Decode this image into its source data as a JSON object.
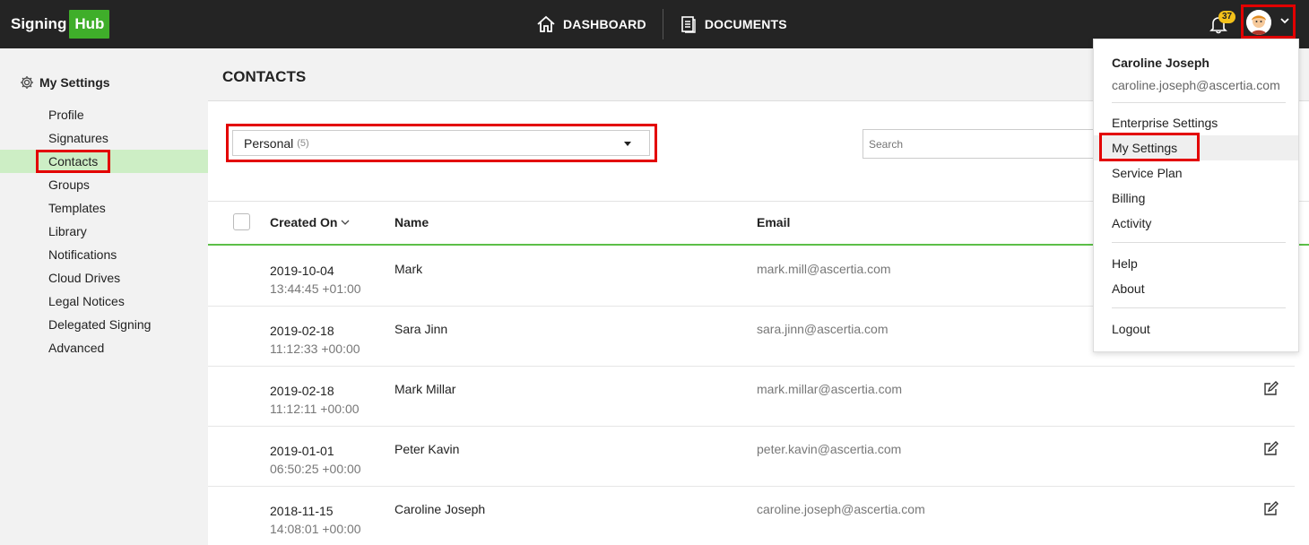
{
  "app": {
    "logo_part1": "Signing",
    "logo_part2": "Hub"
  },
  "nav": {
    "dashboard": "DASHBOARD",
    "documents": "DOCUMENTS"
  },
  "notifications": {
    "count": "37"
  },
  "sidebar": {
    "title": "My Settings",
    "items": [
      {
        "label": "Profile"
      },
      {
        "label": "Signatures"
      },
      {
        "label": "Contacts"
      },
      {
        "label": "Groups"
      },
      {
        "label": "Templates"
      },
      {
        "label": "Library"
      },
      {
        "label": "Notifications"
      },
      {
        "label": "Cloud Drives"
      },
      {
        "label": "Legal Notices"
      },
      {
        "label": "Delegated Signing"
      },
      {
        "label": "Advanced"
      }
    ],
    "active": "Contacts"
  },
  "main": {
    "title": "CONTACTS",
    "filter": {
      "value": "Personal",
      "count": "(5)"
    },
    "search_placeholder": "Search",
    "columns": {
      "created_on": "Created On",
      "name": "Name",
      "email": "Email"
    },
    "rows": [
      {
        "date": "2019-10-04",
        "time": "13:44:45 +01:00",
        "name": "Mark",
        "email": "mark.mill@ascertia.com"
      },
      {
        "date": "2019-02-18",
        "time": "11:12:33 +00:00",
        "name": "Sara Jinn",
        "email": "sara.jinn@ascertia.com"
      },
      {
        "date": "2019-02-18",
        "time": "11:12:11 +00:00",
        "name": "Mark Millar",
        "email": "mark.millar@ascertia.com"
      },
      {
        "date": "2019-01-01",
        "time": "06:50:25 +00:00",
        "name": "Peter Kavin",
        "email": "peter.kavin@ascertia.com"
      },
      {
        "date": "2018-11-15",
        "time": "14:08:01 +00:00",
        "name": "Caroline Joseph",
        "email": "caroline.joseph@ascertia.com"
      }
    ]
  },
  "user_menu": {
    "name": "Caroline Joseph",
    "email": "caroline.joseph@ascertia.com",
    "items": {
      "enterprise_settings": "Enterprise Settings",
      "my_settings": "My Settings",
      "service_plan": "Service Plan",
      "billing": "Billing",
      "activity": "Activity",
      "help": "Help",
      "about": "About",
      "logout": "Logout"
    }
  },
  "colors": {
    "topbar": "#242424",
    "brand_green": "#3fae2a",
    "highlight_red": "#e30000",
    "active_row": "#cdeec5",
    "badge": "#f3c11a"
  },
  "icons": {
    "dashboard": "home-icon",
    "documents": "document-icon",
    "notifications": "bell-icon",
    "settings": "gear-icon",
    "edit": "edit-icon",
    "sort": "chevron-down-icon",
    "user_menu": "chevron-down-icon"
  }
}
